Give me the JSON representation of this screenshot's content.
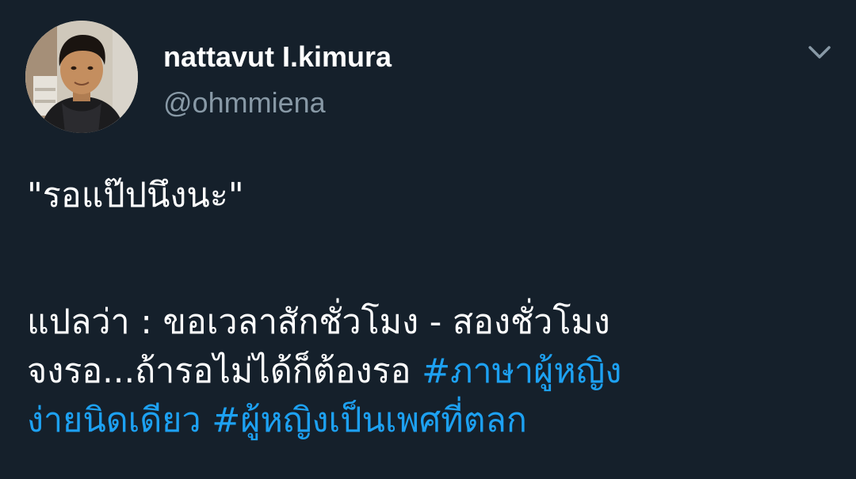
{
  "author": {
    "display_name": "nattavut I.kimura",
    "handle": "@ohmmiena"
  },
  "menu": {
    "icon": "chevron-down-icon"
  },
  "tweet": {
    "quote_line": "\"รอแป๊ปนึงนะ\"",
    "translation_line_1": "แปลว่า : ขอเวลาสักชั่วโมง - สองชั่วโมง",
    "translation_line_2_text": "จงรอ...ถ้ารอไม่ได้ก็ต้องรอ ",
    "hashtag_1_part_1": "#ภาษาผู้หญิง",
    "hashtag_1_part_2": "ง่ายนิดเดียว",
    "separator": " ",
    "hashtag_2": "#ผู้หญิงเป็นเพศที่ตลก"
  },
  "colors": {
    "background": "#15202b",
    "text": "#ffffff",
    "secondary_text": "#8899a6",
    "hashtag": "#1da1f2"
  }
}
